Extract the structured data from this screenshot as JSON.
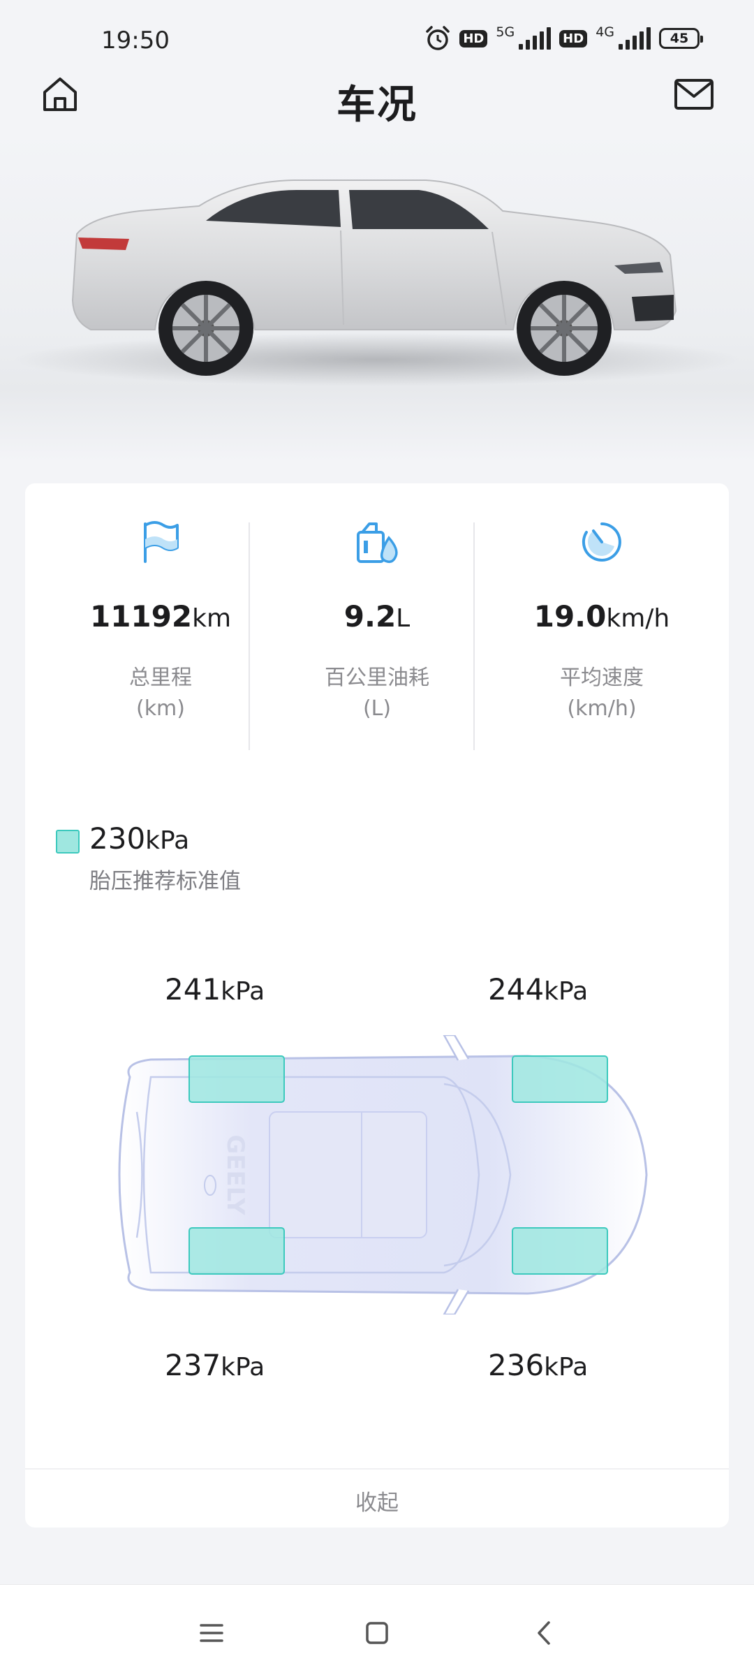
{
  "status_bar": {
    "time": "19:50",
    "network_1": "5G",
    "network_2": "4G",
    "hd_label": "HD",
    "battery": "45",
    "icons": [
      "alarm-icon",
      "hd-icon",
      "signal-icon",
      "battery-icon"
    ]
  },
  "header": {
    "title": "车况",
    "left_icon": "home-icon",
    "right_icon": "mail-icon"
  },
  "stats": [
    {
      "icon": "flag-icon",
      "value": "11192",
      "unit": "km",
      "label": "总里程",
      "sub_label": "(km)"
    },
    {
      "icon": "fuel-icon",
      "value": "9.2",
      "unit": "L",
      "label": "百公里油耗",
      "sub_label": "(L)"
    },
    {
      "icon": "speed-icon",
      "value": "19.0",
      "unit": "km/h",
      "label": "平均速度",
      "sub_label": "(km/h)"
    }
  ],
  "tire_pressure": {
    "standard_value": "230",
    "standard_unit": "kPa",
    "standard_label": "胎压推荐标准值",
    "front_left": "241",
    "front_right": "244",
    "rear_left": "237",
    "rear_right": "236",
    "unit": "kPa",
    "car_brand_mark": "GEELY",
    "highlight_color": "#9fe7e0"
  },
  "collapse_label": "收起",
  "nav": {
    "menu_icon": "menu-icon",
    "home_icon": "square-home-icon",
    "back_icon": "back-icon"
  }
}
